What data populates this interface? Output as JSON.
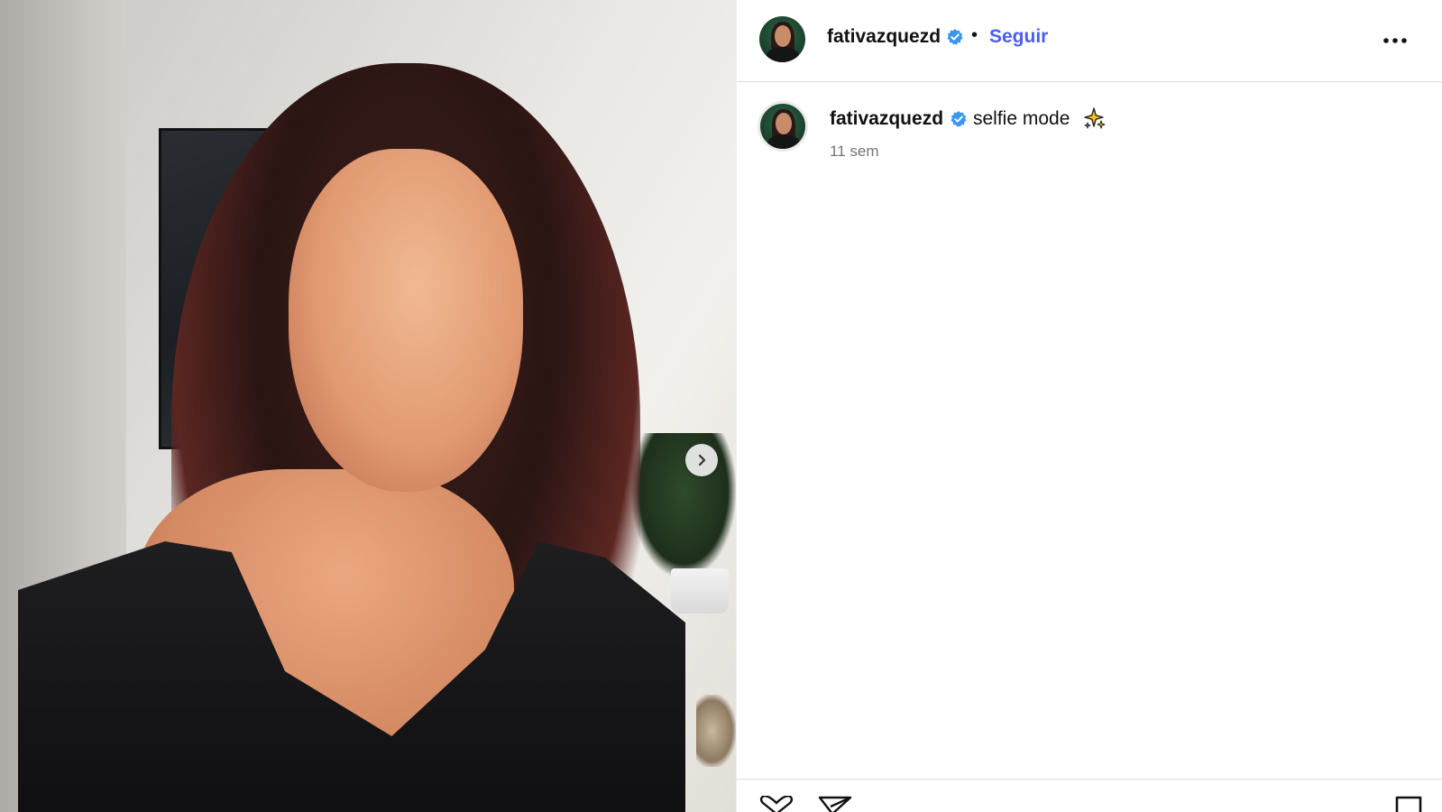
{
  "post": {
    "username": "fativazquezd",
    "follow_label": "Seguir",
    "separator": "•",
    "caption_text": "selfie mode",
    "timestamp": "11 sem"
  },
  "icons": {
    "verified": "verified-badge-icon",
    "more": "more-options-icon",
    "next": "chevron-right-icon",
    "sparkle": "sparkles-emoji-icon",
    "like": "heart-icon",
    "share": "paper-plane-icon",
    "save": "bookmark-icon"
  },
  "colors": {
    "follow": "#4a5df9",
    "verified": "#3897f0",
    "timestamp": "#737373",
    "divider": "#dbdbdb"
  }
}
